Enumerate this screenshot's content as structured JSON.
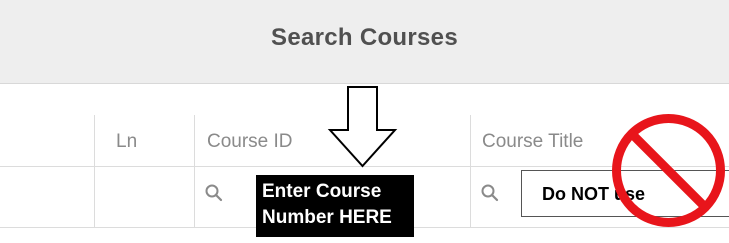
{
  "header": {
    "title": "Search Courses"
  },
  "columns": [
    {
      "label": "Ln"
    },
    {
      "label": "Course ID"
    },
    {
      "label": "Course Title"
    }
  ],
  "annotations": {
    "course_id_note": [
      "Enter Course",
      "Number HERE"
    ],
    "title_warning": "Do NOT use"
  },
  "icons": {
    "course_id_search": "search-icon",
    "course_title_search": "search-icon",
    "arrow": "down-arrow-icon",
    "prohibited": "prohibited-icon"
  },
  "colors": {
    "header_bg": "#eeeeee",
    "header_text": "#505050",
    "column_text": "#8a8a8a",
    "prohibited_red": "#e8151b"
  }
}
